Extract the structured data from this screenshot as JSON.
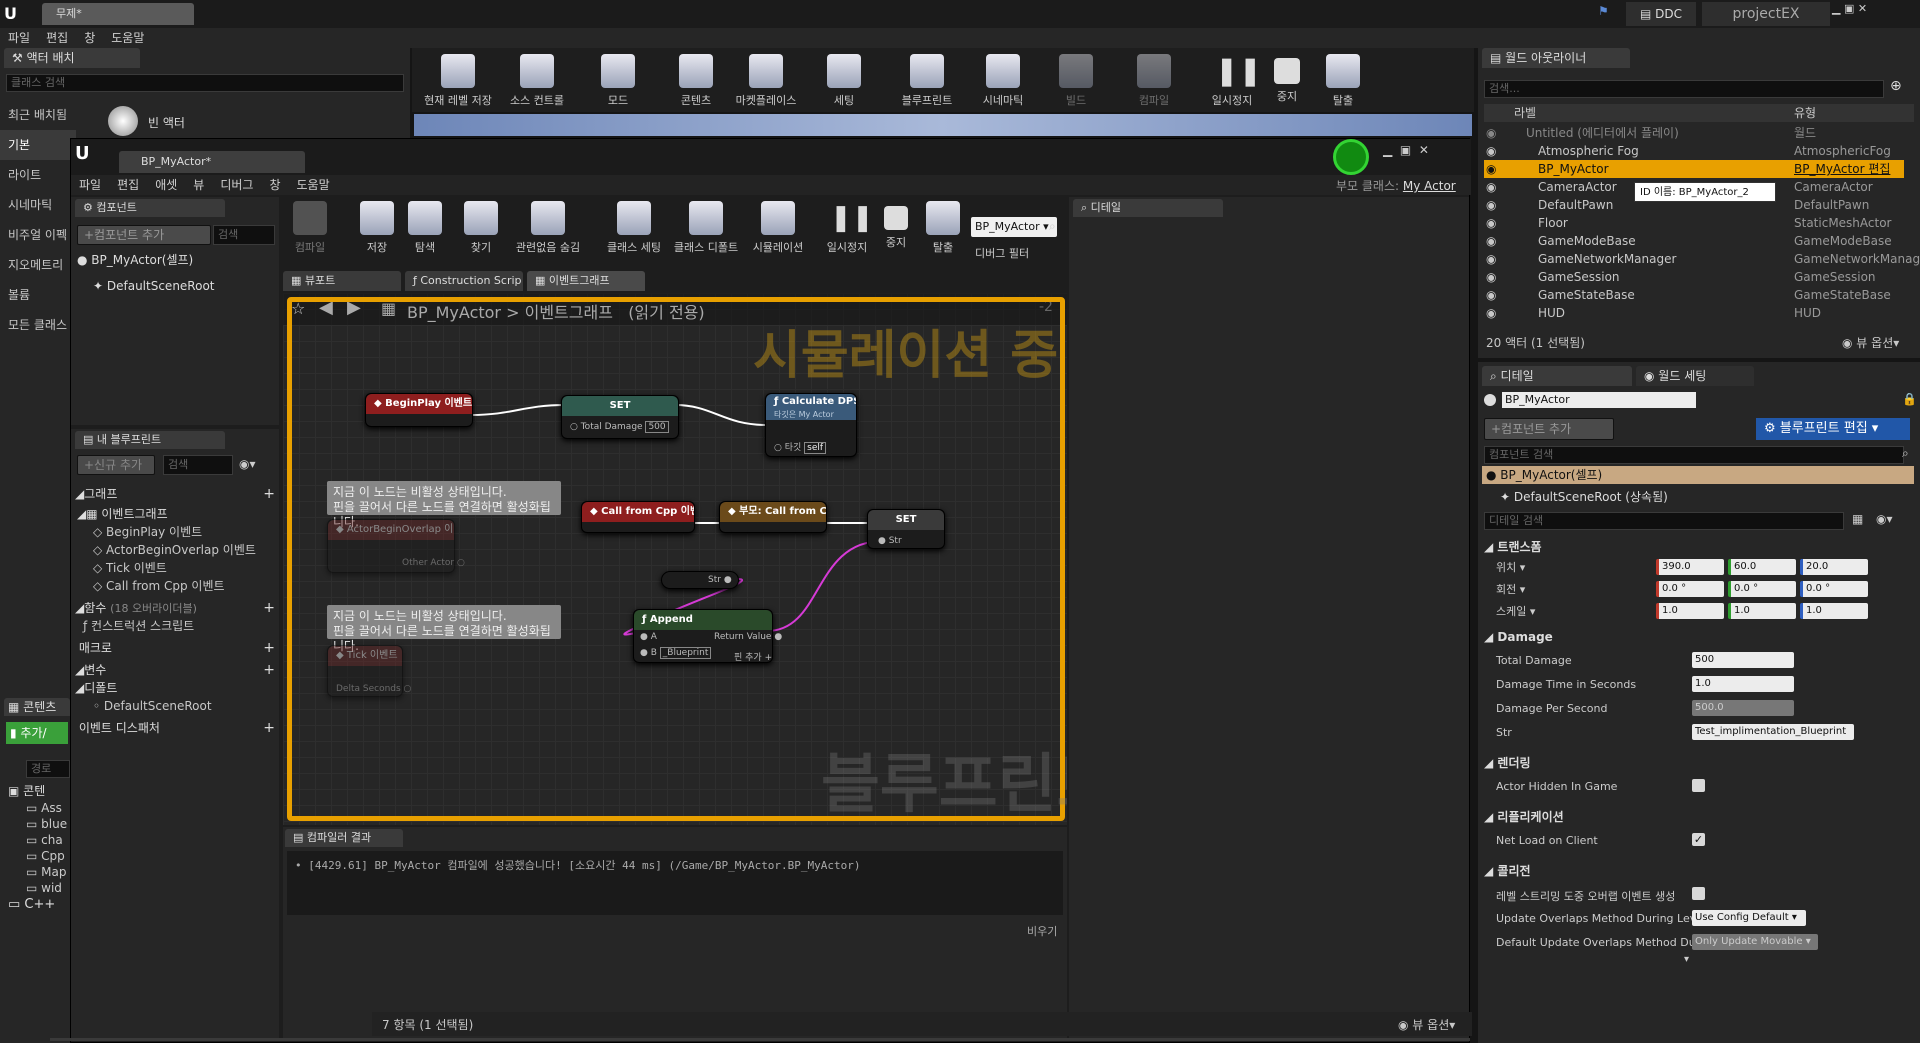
{
  "app": {
    "doc_tab": "무제*",
    "project": "projectEX",
    "ddc": "DDC",
    "menu": [
      "파일",
      "편집",
      "창",
      "도움말"
    ]
  },
  "place_actors": {
    "tab": "액터 배치",
    "search_placeholder": "클래스 검색",
    "categories": [
      "최근 배치됨",
      "기본",
      "라이트",
      "시네마틱",
      "비주얼 이펙",
      "지오메트리",
      "볼륨",
      "모든 클래스"
    ],
    "first_item": "빈 액터"
  },
  "main_toolbar": {
    "buttons": [
      "현재 레벨 저장",
      "소스 컨트롤",
      "모드",
      "콘텐츠",
      "마켓플레이스",
      "세팅",
      "블루프린트",
      "시네마틱",
      "빌드",
      "컴파일",
      "일시정지",
      "중지",
      "탈출"
    ]
  },
  "content_browser": {
    "tab": "콘텐츠",
    "add_button": "추가/",
    "path_search": "경로",
    "root": "콘텐",
    "folders": [
      "Ass",
      "blue",
      "cha",
      "Cpp",
      "Map",
      "wid"
    ],
    "cpp": "C++"
  },
  "blueprint_editor": {
    "tab": "BP_MyActor*",
    "menu": [
      "파일",
      "편집",
      "애셋",
      "뷰",
      "디버그",
      "창",
      "도움말"
    ],
    "parent_class_label": "부모 클래스:",
    "parent_class": "My Actor",
    "toolbar": [
      "컴파일",
      "저장",
      "탐색",
      "찾기",
      "관련없음 숨김",
      "클래스 세팅",
      "클래스 디폴트",
      "시뮬레이션",
      "일시정지",
      "중지",
      "탈출"
    ],
    "debug_object": "BP_MyActor",
    "debug_filter": "디버그 필터",
    "components_tab": "컴포넌트",
    "add_component": "+컴포넌트 추가",
    "search_placeholder": "검색",
    "components": [
      "BP_MyActor(셀프)",
      "DefaultSceneRoot"
    ],
    "my_blueprint_tab": "내 블루프린트",
    "add_new": "+신규 추가",
    "graphs_header": "그래프",
    "event_graph": "이벤트그래프",
    "events": [
      "BeginPlay 이벤트",
      "ActorBeginOverlap 이벤트",
      "Tick 이벤트",
      "Call from Cpp 이벤트"
    ],
    "functions_header": "함수",
    "functions_note": "(18 오버라이더블)",
    "construction_script": "컨스트럭션 스크립트",
    "macros_header": "매크로",
    "variables_header": "변수",
    "defaults_header": "디폴트",
    "default_scene_root": "DefaultSceneRoot",
    "dispatchers_header": "이벤트 디스패처",
    "graph_tabs": [
      "뷰포트",
      "Construction Scrip",
      "이벤트그래프"
    ],
    "details_tab": "디테일",
    "breadcrumb_bp": "BP_MyActor",
    "breadcrumb_sep": ">",
    "breadcrumb_graph": "이벤트그래프",
    "breadcrumb_readonly": "(읽기 전용)",
    "zoom": "-2",
    "simulating_watermark": "시뮬레이션 중",
    "blueprint_watermark": "블루프린트",
    "compiler_tab": "컴파일러 결과",
    "compiler_message": "[4429.61] BP_MyActor 컴파일에 성공했습니다! [소요시간 44 ms] (/Game/BP_MyActor.BP_MyActor)",
    "clear": "비우기"
  },
  "nodes": {
    "beginplay": "BeginPlay 이벤트",
    "set1": "SET",
    "total_damage": "Total Damage",
    "total_damage_val": "500",
    "calc_dps": "Calculate DPS",
    "calc_dps_sub": "타깃은 My Actor",
    "target": "타깃",
    "self": "self",
    "comment1_line1": "지금 이 노드는 비활성 상태입니다.",
    "comment1_line2": "핀을 끌어서 다른 노드를 연결하면 활성화됩니다.",
    "overlap": "ActorBeginOverlap 이벤트",
    "other_actor": "Other Actor",
    "call_from_cpp": "Call from Cpp 이벤트",
    "parent_call": "부모: Call from Cpp",
    "set2": "SET",
    "str": "Str",
    "str_get": "Str",
    "append": "Append",
    "a": "A",
    "return_value": "Return Value",
    "b": "B",
    "b_val": "_Blueprint",
    "add_pin": "핀 추가",
    "comment2_line1": "지금 이 노드는 비활성 상태입니다.",
    "comment2_line2": "핀을 끌어서 다른 노드를 연결하면 활성화됩니다.",
    "tick": "Tick 이벤트",
    "delta": "Delta Seconds"
  },
  "status_bar": {
    "items": "7 항목 (1 선택됨)",
    "view_options": "뷰 옵션"
  },
  "outliner": {
    "tab": "월드 아웃라이너",
    "search_placeholder": "검색...",
    "col_label": "라벨",
    "col_type": "유형",
    "rows": [
      {
        "label": "Untitled (에디터에서 플레이)",
        "type": "월드"
      },
      {
        "label": "Atmospheric Fog",
        "type": "AtmosphericFog"
      },
      {
        "label": "BP_MyActor",
        "type": "BP_MyActor 편집"
      },
      {
        "label": "CameraActor",
        "type": "CameraActor"
      },
      {
        "label": "DefaultPawn",
        "type": "DefaultPawn"
      },
      {
        "label": "Floor",
        "type": "StaticMeshActor"
      },
      {
        "label": "GameModeBase",
        "type": "GameModeBase"
      },
      {
        "label": "GameNetworkManager",
        "type": "GameNetworkManag"
      },
      {
        "label": "GameSession",
        "type": "GameSession"
      },
      {
        "label": "GameStateBase",
        "type": "GameStateBase"
      },
      {
        "label": "HUD",
        "type": "HUD"
      }
    ],
    "tooltip": "ID 이름: BP_MyActor_2",
    "count": "20 액터 (1 선택됨)",
    "view_options": "뷰 옵션"
  },
  "details": {
    "tab": "디테일",
    "world_settings_tab": "월드 세팅",
    "name": "BP_MyActor",
    "add_component": "+컴포넌트 추가",
    "edit_blueprint": "블루프린트 편집",
    "component_search": "컴포넌트 검색",
    "self_row": "BP_MyActor(셀프)",
    "root_row": "DefaultSceneRoot (상속됨)",
    "details_search": "디테일 검색",
    "transform": "트랜스폼",
    "location": "위치",
    "rotation": "회전",
    "scale": "스케일",
    "loc": [
      "390.0",
      "60.0",
      "20.0"
    ],
    "rot": [
      "0.0 °",
      "0.0 °",
      "0.0 °"
    ],
    "scl": [
      "1.0",
      "1.0",
      "1.0"
    ],
    "damage": "Damage",
    "total_damage": "Total Damage",
    "total_damage_val": "500",
    "damage_time": "Damage Time in Seconds",
    "damage_time_val": "1.0",
    "dps": "Damage Per Second",
    "dps_val": "500.0",
    "str": "Str",
    "str_val": "Test_implimentation_Blueprint",
    "rendering": "렌더링",
    "hidden": "Actor Hidden In Game",
    "replication": "리플리케이션",
    "net_load": "Net Load on Client",
    "collision": "콜리전",
    "streaming": "레벨 스트리밍 도중 오버랩 이벤트 생성",
    "update_overlaps": "Update Overlaps Method During Level",
    "update_overlaps_val": "Use Config Default",
    "default_update": "Default Update Overlaps Method Durin",
    "default_update_val": "Only Update Movable"
  },
  "colors": {
    "accent": "#e8a000",
    "selected_row": "#e8a000",
    "event_red": "#8e1e1e",
    "func_blue": "#3a5a7a",
    "var_teal": "#2f5a4e",
    "string_pin": "#d63ad6",
    "exec_white": "#ffffff"
  }
}
